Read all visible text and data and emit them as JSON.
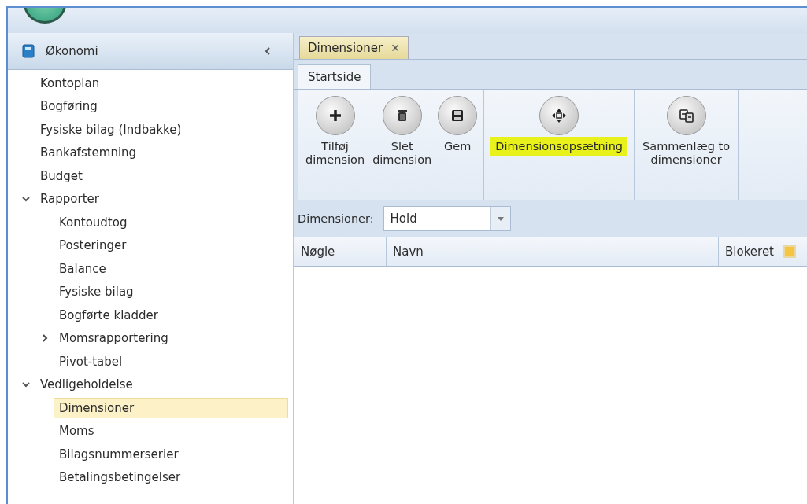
{
  "sidebar": {
    "title": "Økonomi",
    "items": [
      {
        "label": "Kontoplan",
        "selected": false
      },
      {
        "label": "Bogføring",
        "selected": false
      },
      {
        "label": "Fysiske bilag (Indbakke)",
        "selected": false
      },
      {
        "label": "Bankafstemning",
        "selected": false
      },
      {
        "label": "Budget",
        "selected": false
      },
      {
        "label": "Rapporter",
        "selected": false,
        "expanded": true,
        "children": [
          {
            "label": "Kontoudtog",
            "selected": false
          },
          {
            "label": "Posteringer",
            "selected": false
          },
          {
            "label": "Balance",
            "selected": false
          },
          {
            "label": "Fysiske bilag",
            "selected": false
          },
          {
            "label": "Bogførte kladder",
            "selected": false
          },
          {
            "label": "Momsrapportering",
            "selected": false,
            "expanded": false
          },
          {
            "label": "Pivot-tabel",
            "selected": false
          }
        ]
      },
      {
        "label": "Vedligeholdelse",
        "selected": false,
        "expanded": true,
        "children": [
          {
            "label": "Dimensioner",
            "selected": true
          },
          {
            "label": "Moms",
            "selected": false
          },
          {
            "label": "Bilagsnummerserier",
            "selected": false
          },
          {
            "label": "Betalingsbetingelser",
            "selected": false
          }
        ]
      }
    ]
  },
  "tabs": [
    {
      "label": "Dimensioner",
      "close": "✕",
      "selected": true
    }
  ],
  "ribbon": {
    "tabs": [
      {
        "label": "Startside",
        "selected": true
      }
    ],
    "groups": [
      [
        {
          "kind": "add",
          "label": "Tilføj\ndimension",
          "highlighted": false
        },
        {
          "kind": "delete",
          "label": "Slet\ndimension",
          "highlighted": false
        },
        {
          "kind": "save",
          "label": "Gem",
          "highlighted": false
        }
      ],
      [
        {
          "kind": "move",
          "label": "Dimensionsopsætning",
          "highlighted": true
        }
      ],
      [
        {
          "kind": "merge",
          "label": "Sammenlæg to\ndimensioner",
          "highlighted": false
        }
      ]
    ]
  },
  "filter": {
    "label": "Dimensioner:",
    "value": "Hold"
  },
  "table": {
    "columns": [
      {
        "label": "Nøgle"
      },
      {
        "label": "Navn"
      },
      {
        "label": "Blokeret",
        "kind": "check"
      }
    ]
  }
}
